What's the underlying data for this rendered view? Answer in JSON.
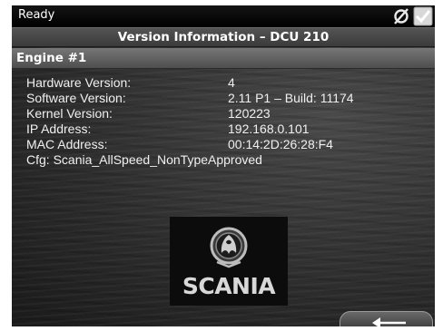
{
  "status": {
    "text": "Ready",
    "icons": [
      "no-link-icon",
      "check-icon"
    ]
  },
  "title": "Version Information – DCU 210",
  "section": "Engine #1",
  "rows": [
    {
      "label": "Hardware Version:",
      "value": "4"
    },
    {
      "label": "Software Version:",
      "value": "2.11 P1 – Build: 11174"
    },
    {
      "label": "Kernel Version:",
      "value": "120223"
    },
    {
      "label": "IP Address:",
      "value": "192.168.0.101"
    },
    {
      "label": "MAC Address:",
      "value": "00:14:2D:26:28:F4"
    }
  ],
  "cfg": "Cfg: Scania_AllSpeed_NonTypeApproved",
  "logo": {
    "word": "SCANIA"
  },
  "back_button": {
    "icon": "back-arrow-icon"
  }
}
